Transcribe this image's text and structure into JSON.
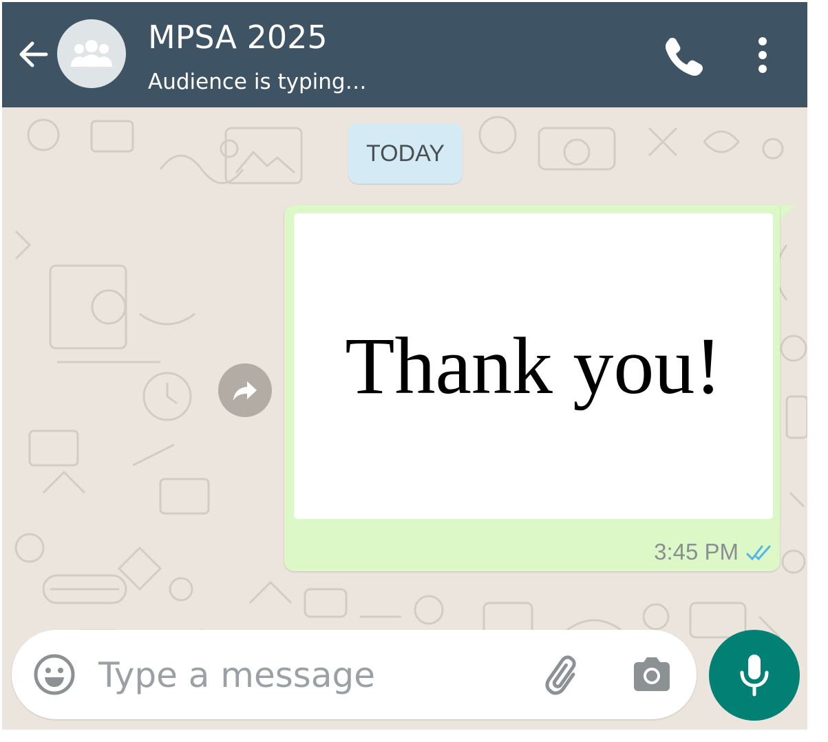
{
  "colors": {
    "header_bg": "#3e5464",
    "chat_bg": "#ece5dd",
    "outgoing_bubble": "#dcf8c6",
    "date_chip": "#d4eaf4",
    "mic_button": "#028074",
    "read_ticks": "#4fb6ec"
  },
  "header": {
    "back_icon": "arrow-left-icon",
    "avatar_icon": "group-icon",
    "title": "MPSA 2025",
    "subtitle": "Audience is typing…",
    "actions": [
      "phone-icon",
      "more-vertical-icon"
    ]
  },
  "chat": {
    "date_divider": "TODAY",
    "forward_icon": "forward-icon",
    "message": {
      "image_text": "Thank you!",
      "time": "3:45 PM",
      "status_icon": "double-check-icon",
      "status": "read"
    }
  },
  "composer": {
    "emoji_icon": "emoji-icon",
    "placeholder": "Type a message",
    "attach_icon": "paperclip-icon",
    "camera_icon": "camera-icon",
    "mic_icon": "microphone-icon"
  }
}
